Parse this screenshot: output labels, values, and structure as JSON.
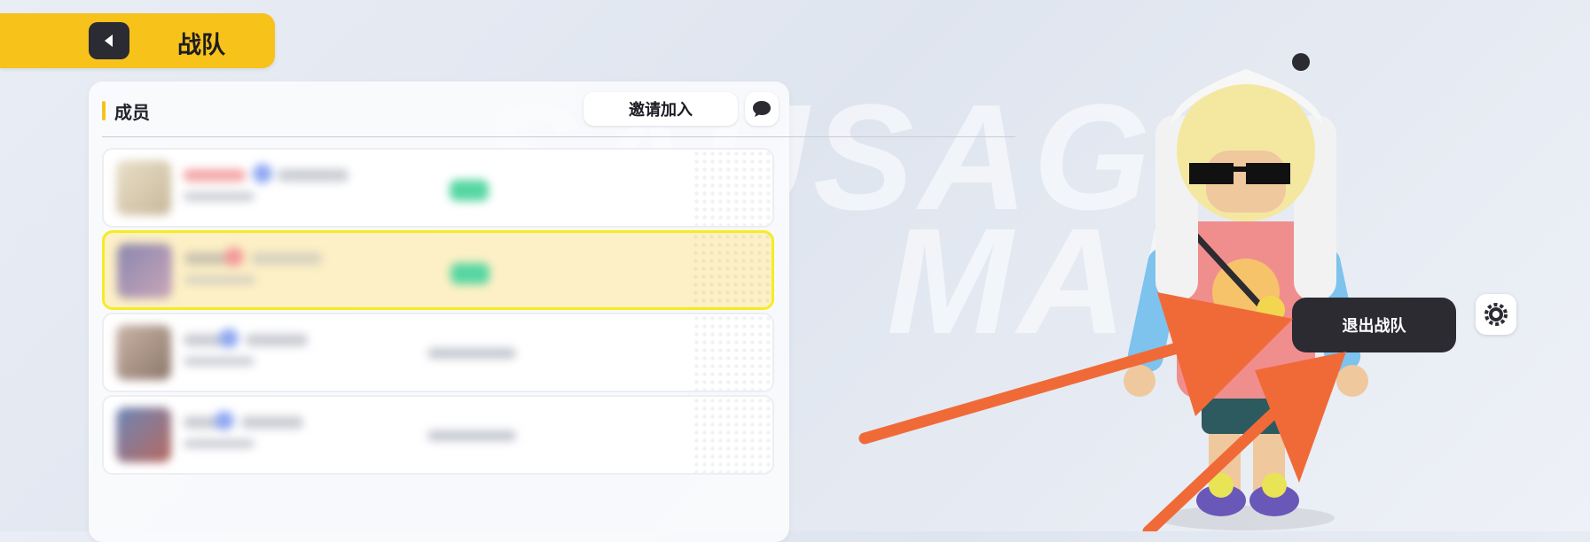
{
  "header": {
    "title": "战队"
  },
  "members_section": {
    "title": "成员",
    "invite_label": "邀请加入"
  },
  "members": [
    {
      "status": "online",
      "selected": false
    },
    {
      "status": "online",
      "selected": true
    },
    {
      "status": "offline",
      "selected": false
    },
    {
      "status": "offline",
      "selected": false
    }
  ],
  "actions": {
    "leave_label": "退出战队"
  },
  "icons": {
    "back": "back-arrow-icon",
    "chat": "chat-bubble-icon",
    "settings": "gear-icon"
  },
  "colors": {
    "accent": "#f7c21a",
    "selected_row": "#fdf0c6",
    "selected_border": "#f5ec22",
    "dark_button": "#2b2b31",
    "annotation_arrow": "#f06a38",
    "online_badge": "#57d6a2"
  }
}
